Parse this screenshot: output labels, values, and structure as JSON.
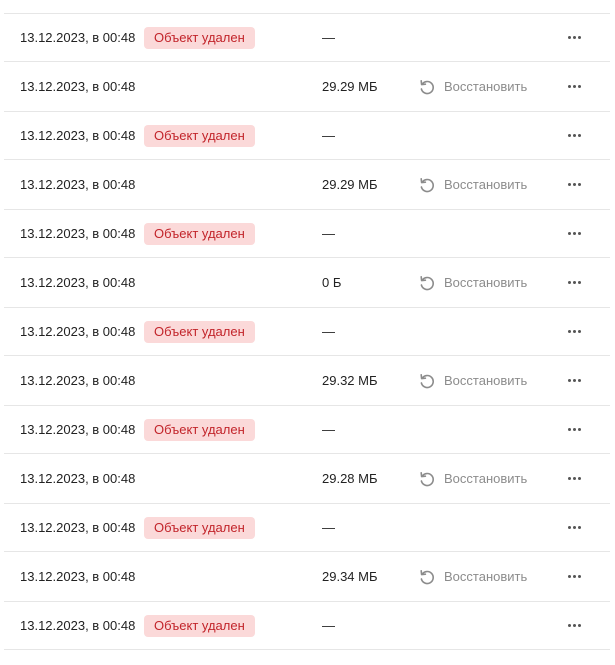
{
  "colors": {
    "badge_bg": "#fbd9d9",
    "badge_text": "#c2242a",
    "restore_text": "#8c8c8c",
    "divider": "#e6e6e6"
  },
  "rows": [
    {
      "date": "13.12.2023, в 00:48",
      "status": "Объект удален",
      "size": "—",
      "restore": ""
    },
    {
      "date": "13.12.2023, в 00:48",
      "status": "",
      "size": "29.29 МБ",
      "restore": "Восстановить"
    },
    {
      "date": "13.12.2023, в 00:48",
      "status": "Объект удален",
      "size": "—",
      "restore": ""
    },
    {
      "date": "13.12.2023, в 00:48",
      "status": "",
      "size": "29.29 МБ",
      "restore": "Восстановить"
    },
    {
      "date": "13.12.2023, в 00:48",
      "status": "Объект удален",
      "size": "—",
      "restore": ""
    },
    {
      "date": "13.12.2023, в 00:48",
      "status": "",
      "size": "0 Б",
      "restore": "Восстановить"
    },
    {
      "date": "13.12.2023, в 00:48",
      "status": "Объект удален",
      "size": "—",
      "restore": ""
    },
    {
      "date": "13.12.2023, в 00:48",
      "status": "",
      "size": "29.32 МБ",
      "restore": "Восстановить"
    },
    {
      "date": "13.12.2023, в 00:48",
      "status": "Объект удален",
      "size": "—",
      "restore": ""
    },
    {
      "date": "13.12.2023, в 00:48",
      "status": "",
      "size": "29.28 МБ",
      "restore": "Восстановить"
    },
    {
      "date": "13.12.2023, в 00:48",
      "status": "Объект удален",
      "size": "—",
      "restore": ""
    },
    {
      "date": "13.12.2023, в 00:48",
      "status": "",
      "size": "29.34 МБ",
      "restore": "Восстановить"
    },
    {
      "date": "13.12.2023, в 00:48",
      "status": "Объект удален",
      "size": "—",
      "restore": ""
    }
  ],
  "icons": {
    "restore": "undo-arrow-icon",
    "more": "more-horizontal-icon"
  }
}
